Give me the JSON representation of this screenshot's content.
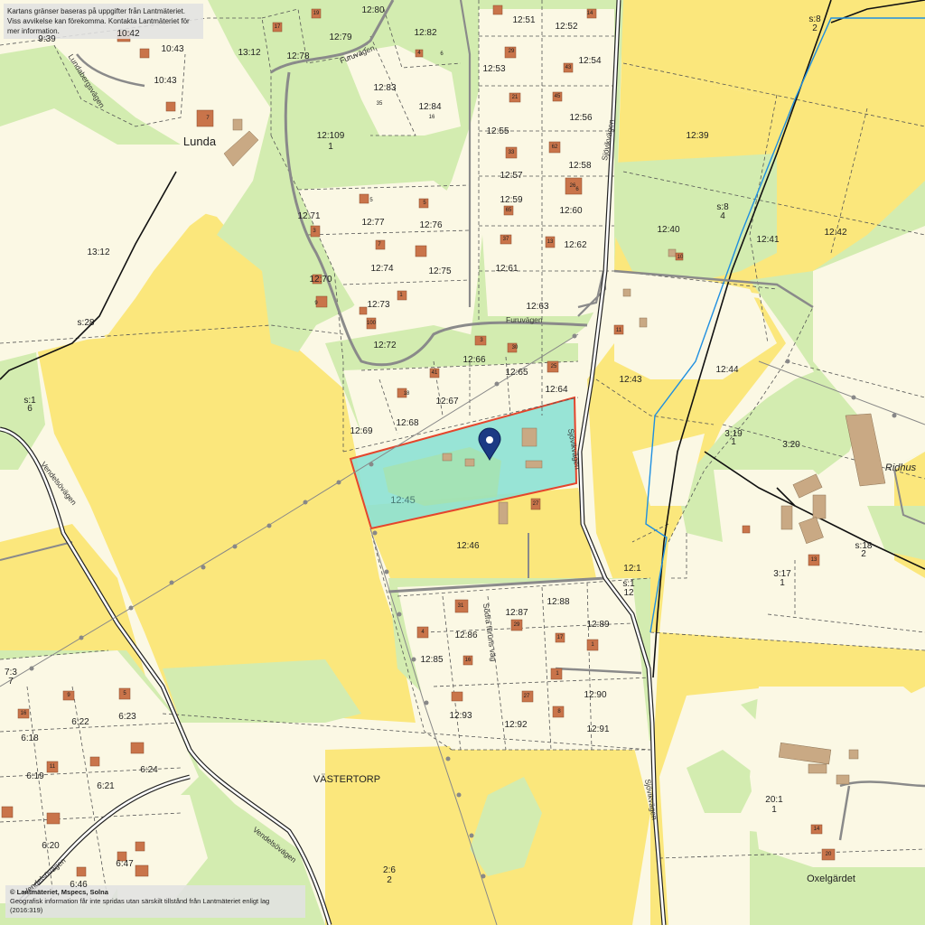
{
  "disclaimer": {
    "line1": "Kartans gränser baseras på uppgifter från Lantmäteriet.",
    "line2": "Viss avvikelse kan förekomma. Kontakta Lantmäteriet för mer information."
  },
  "copyright": {
    "line1": "© Lantmäteriet, Mspecs, Solna",
    "line2": "Geografisk information får inte spridas utan särskilt tillstånd från Lantmäteriet enligt lag (2016:319)"
  },
  "colors": {
    "agricultural": "#fbe77c",
    "forest": "#d3ecb0",
    "open": "#fbf8e4",
    "building": "#c9a984",
    "house": "#c9744a",
    "selected_fill": "#8de1d4",
    "selected_border": "#e5452c",
    "pin": "#1b3a84",
    "stream": "#1f8fe0"
  },
  "places": {
    "lunda": "Lunda",
    "vastertorp": "VÄSTERTORP",
    "oxelgardet": "Oxelgärdet",
    "ridhus": "Ridhus"
  },
  "roads": {
    "furuvagen_north": "Furuvägen",
    "furuvagen_mid": "Furuvägen",
    "lundabergsvagen": "Lundabergsvägen",
    "sjovikvagen_north": "Sjövikvägen",
    "sjovikvagen_mid": "Sjövikvägen",
    "sjovikvagen_south": "Sjövikvägen",
    "vendelsovagen_west": "Vendelsövägen",
    "vendelsovagen_south": "Vendelsövägen",
    "vendelsovagen_sw": "Vendelsövägen",
    "sodra_furuvagen": "Södra furuns väg"
  },
  "selected_parcel": "12:45",
  "parcels": [
    "9:39",
    "10:42",
    "10:43",
    "10:43",
    "13:12",
    "12:79",
    "12:80",
    "12:78",
    "12:82",
    "12:51",
    "12:52",
    "12:53",
    "12:54",
    "12:83",
    "12:84",
    "12:56",
    "12:55",
    "12:109",
    "1",
    "12:39",
    "12:58",
    "12:57",
    "13:12",
    "12:71",
    "12:77",
    "12:76",
    "12:59",
    "12:60",
    "12:40",
    "s:8",
    "4",
    "12:41",
    "12:42",
    "12:62",
    "12:74",
    "12:75",
    "12:61",
    "12:70",
    "12:63",
    "12:73",
    "s:28",
    "12:72",
    "12:66",
    "12:65",
    "12:43",
    "12:44",
    "s:1",
    "6",
    "12:67",
    "12:64",
    "12:69",
    "12:68",
    "3:19",
    "1",
    "3:20",
    "12:46",
    "12:1",
    "s:1",
    "12",
    "s:18",
    "2",
    "3:17",
    "1",
    "12:87",
    "12:88",
    "12:86",
    "12:89",
    "12:85",
    "7:3",
    "7",
    "6:22",
    "6:23",
    "6:18",
    "12:93",
    "12:90",
    "12:92",
    "12:91",
    "6:24",
    "6:19",
    "6:21",
    "VÄSTERTORP",
    "20:1",
    "1",
    "6:20",
    "6:47",
    "6:46",
    "2:6",
    "2",
    "s:8",
    "2"
  ],
  "house_numbers": [
    "17",
    "19",
    "4",
    "6",
    "16",
    "29",
    "43",
    "21",
    "45",
    "33",
    "62",
    "65",
    "37",
    "13",
    "26",
    "35",
    "14",
    "6",
    "5",
    "5",
    "3",
    "9",
    "7",
    "1",
    "100",
    "18",
    "41",
    "3",
    "30",
    "25",
    "7",
    "11",
    "10",
    "27",
    "31",
    "29",
    "4",
    "16",
    "1",
    "17",
    "1",
    "27",
    "8",
    "13",
    "14",
    "20",
    "16",
    "9",
    "5",
    "11"
  ]
}
